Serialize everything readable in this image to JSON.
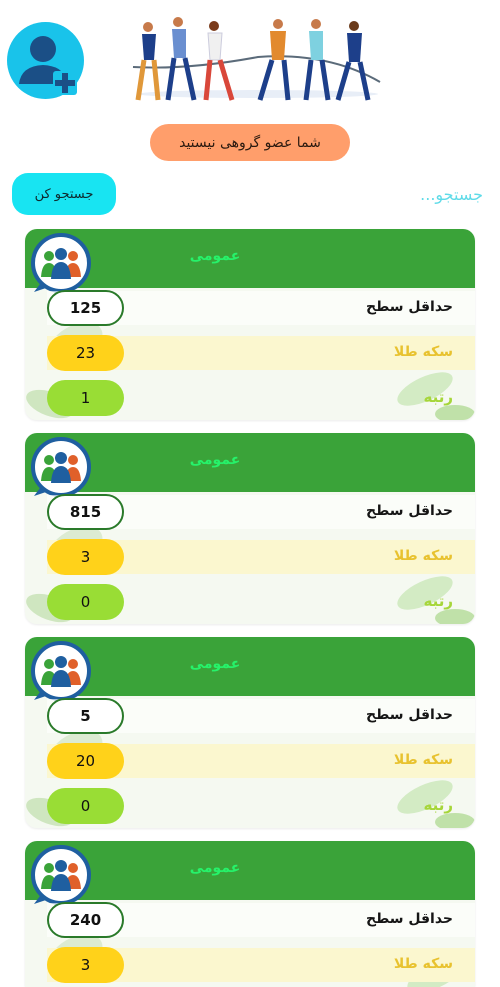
{
  "status": {
    "not_member_text": "شما عضو گروهی نیستید"
  },
  "search": {
    "button_label": "جستجو کن",
    "placeholder": "جستجو..."
  },
  "labels": {
    "min_level": "حداقل سطح",
    "gold_coin": "سکه طلا",
    "rank": "رتبه"
  },
  "groups": [
    {
      "name": "عمومی",
      "min_level": "125",
      "gold_coin": "23",
      "rank": "1"
    },
    {
      "name": "عمومی",
      "min_level": "815",
      "gold_coin": "3",
      "rank": "0"
    },
    {
      "name": "عمومی",
      "min_level": "5",
      "gold_coin": "20",
      "rank": "0"
    },
    {
      "name": "عمومی",
      "min_level": "240",
      "gold_coin": "3"
    }
  ],
  "colors": {
    "header_green": "#3aa339",
    "group_name": "#26f26a",
    "gold": "#ffd21a",
    "rank_green": "#99dd35",
    "accent_cyan": "#19c3ea",
    "notice_orange": "#ff9e6b"
  },
  "icons": {
    "avatar": "add-user-icon",
    "group": "group-people-icon",
    "hero": "tug-of-war-illustration"
  }
}
